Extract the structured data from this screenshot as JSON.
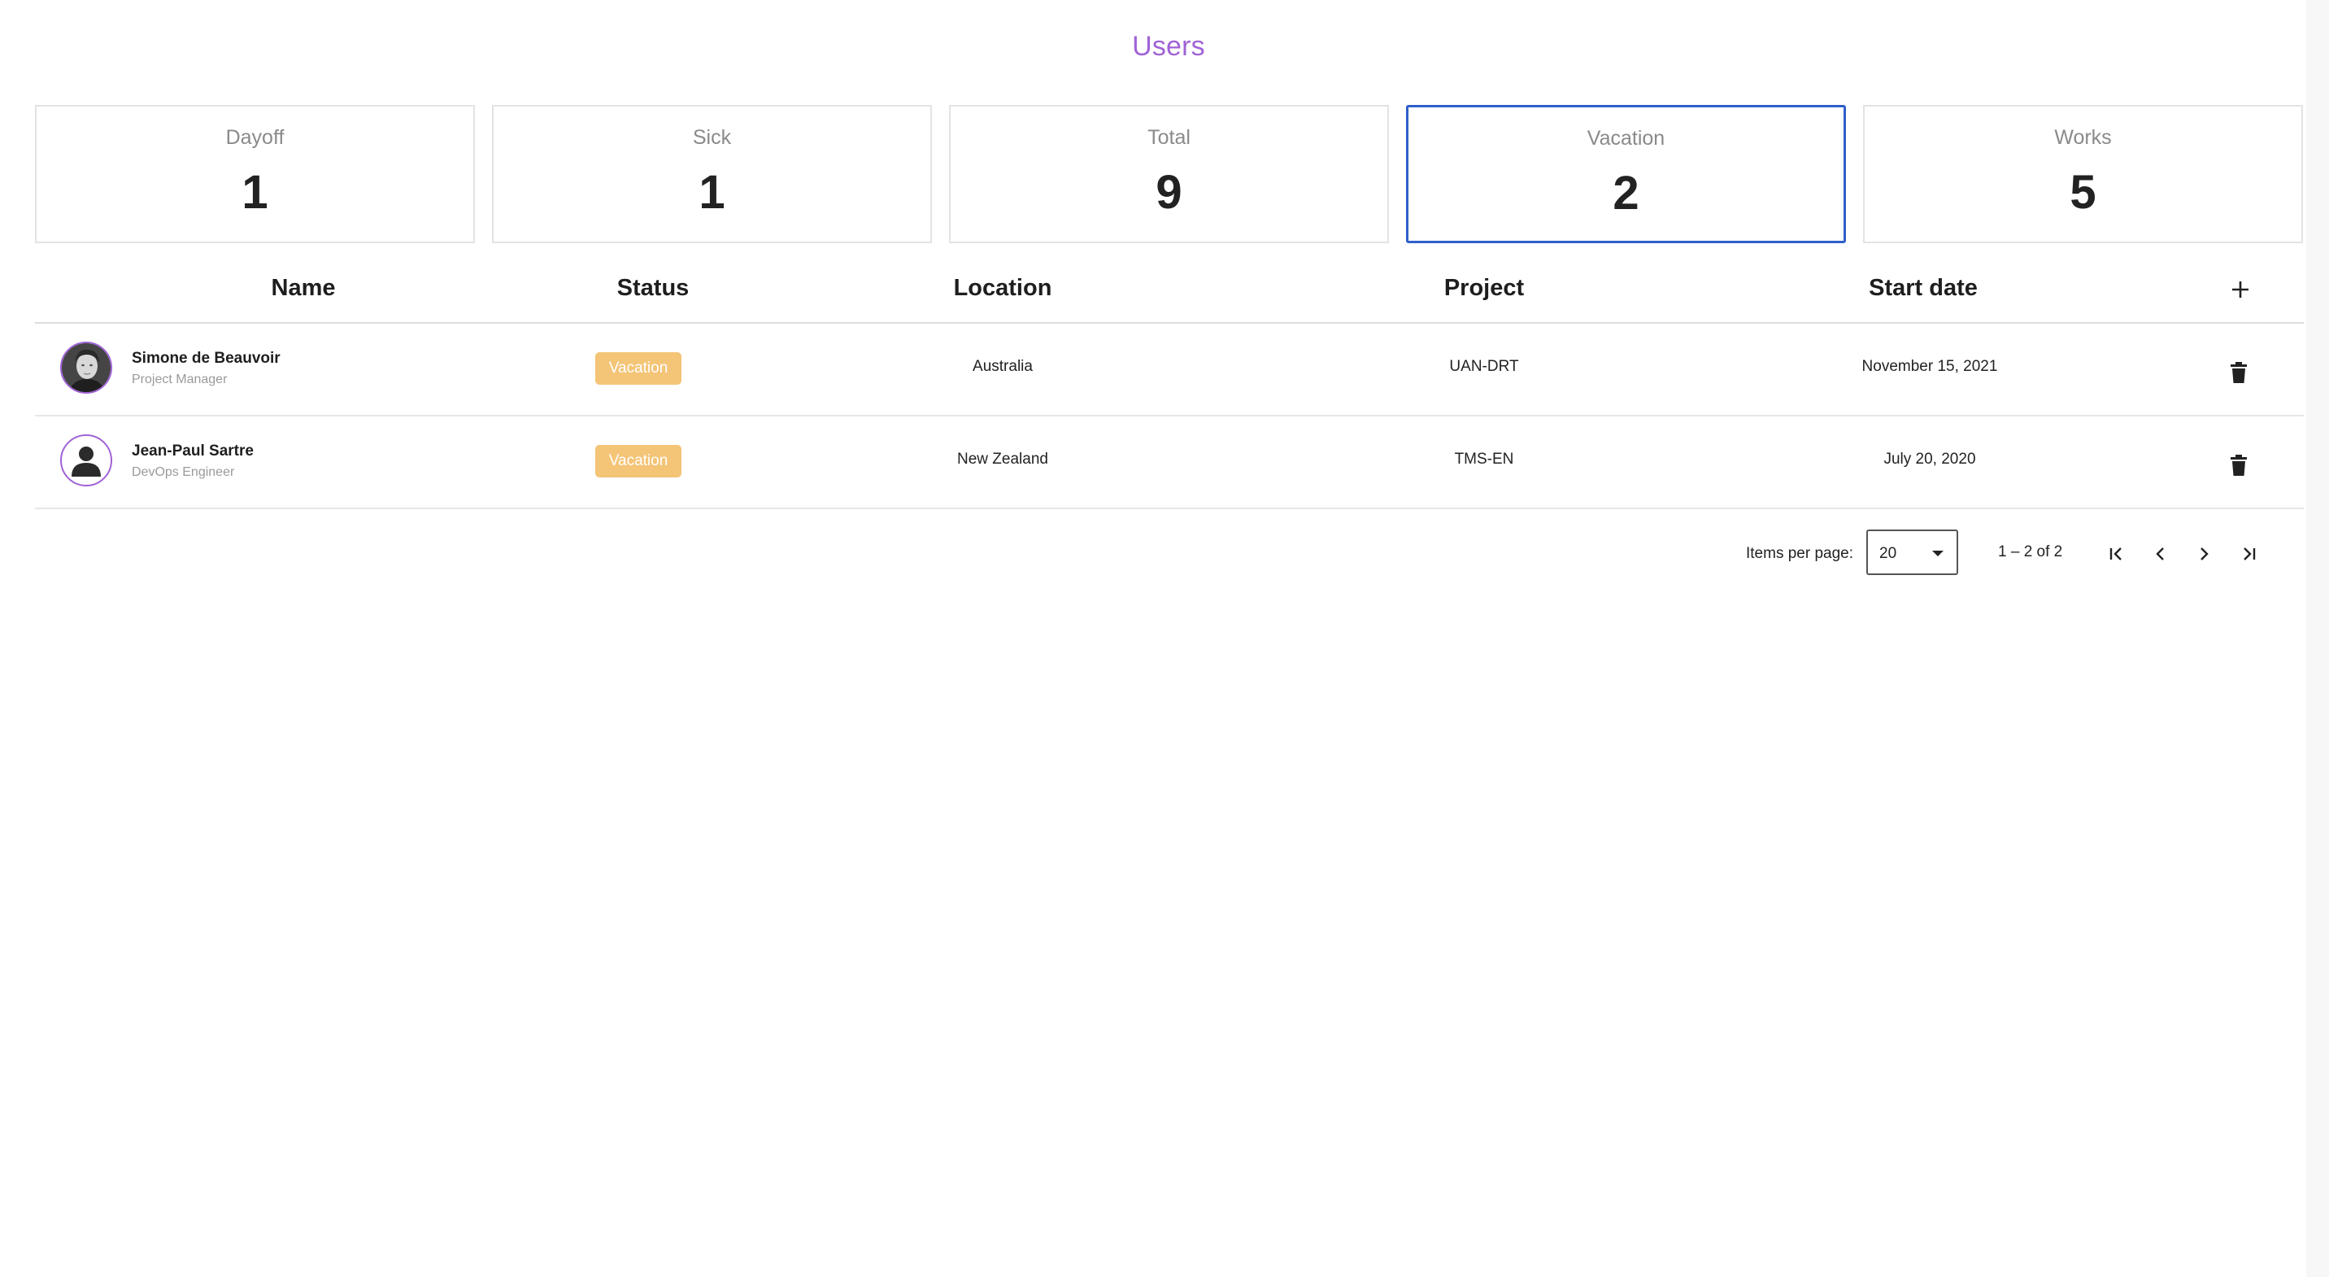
{
  "page": {
    "title": "Users"
  },
  "stats": [
    {
      "label": "Dayoff",
      "value": "1",
      "active": false
    },
    {
      "label": "Sick",
      "value": "1",
      "active": false
    },
    {
      "label": "Total",
      "value": "9",
      "active": false
    },
    {
      "label": "Vacation",
      "value": "2",
      "active": true
    },
    {
      "label": "Works",
      "value": "5",
      "active": false
    }
  ],
  "table": {
    "headers": {
      "name": "Name",
      "status": "Status",
      "location": "Location",
      "project": "Project",
      "start_date": "Start date"
    },
    "add_icon": "plus-icon",
    "delete_icon": "trash-icon",
    "rows": [
      {
        "name": "Simone de Beauvoir",
        "role": "Project Manager",
        "status": "Vacation",
        "location": "Australia",
        "project": "UAN-DRT",
        "start_date": "November 15, 2021",
        "avatar": "photo"
      },
      {
        "name": "Jean-Paul Sartre",
        "role": "DevOps Engineer",
        "status": "Vacation",
        "location": "New Zealand",
        "project": "TMS-EN",
        "start_date": "July 20, 2020",
        "avatar": "placeholder"
      }
    ]
  },
  "paginator": {
    "items_per_page_label": "Items per page:",
    "page_size": "20",
    "range_label": "1 – 2 of 2"
  },
  "colors": {
    "title": "#a063d6",
    "active_card_border": "#2f5fc9",
    "badge_vacation": "#f4c477",
    "avatar_ring": "#a063d6"
  }
}
